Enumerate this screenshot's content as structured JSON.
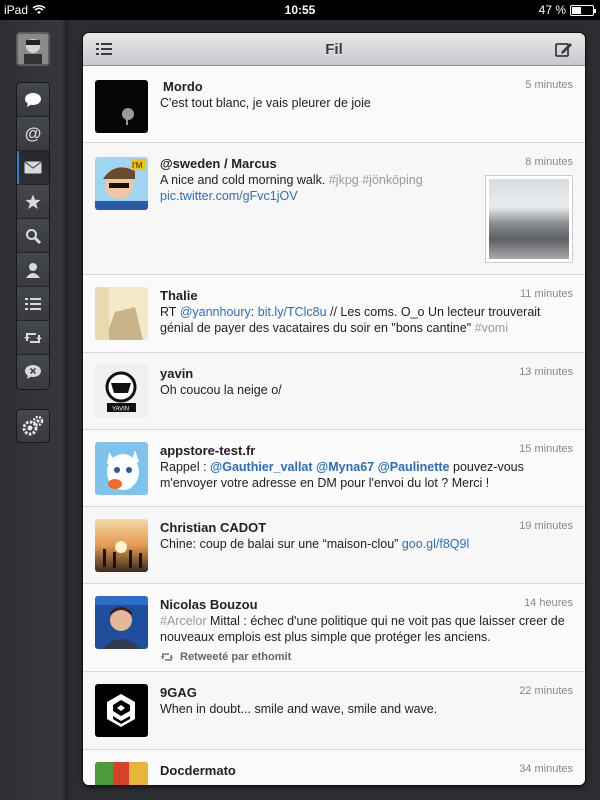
{
  "status_bar": {
    "device": "iPad",
    "time": "10:55",
    "battery": "47 %"
  },
  "sidebar": {
    "items": [
      {
        "name": "timeline",
        "icon": "speech-bubble-icon"
      },
      {
        "name": "mentions",
        "icon": "at-icon"
      },
      {
        "name": "messages",
        "icon": "envelope-icon"
      },
      {
        "name": "favorites",
        "icon": "star-icon"
      },
      {
        "name": "search",
        "icon": "search-icon"
      },
      {
        "name": "profile",
        "icon": "person-icon"
      },
      {
        "name": "lists",
        "icon": "list-icon"
      },
      {
        "name": "retweets",
        "icon": "retweet-icon"
      },
      {
        "name": "mute",
        "icon": "mute-icon"
      }
    ],
    "active": "messages",
    "accent_color": "#2a7fd4"
  },
  "header": {
    "title": "Fil"
  },
  "tweets": [
    {
      "name": "Mordo",
      "time": "5 minutes",
      "text": "C'est tout blanc, je vais pleurer de joie"
    },
    {
      "name": "@sweden / Marcus",
      "time": "8 minutes",
      "text_plain": "A nice and cold morning walk.",
      "hashtags": "#jkpg #jönköping",
      "link": "pic.twitter.com/gFvc1jOV"
    },
    {
      "name": "Thalie",
      "time": "11 minutes",
      "prefix": "RT",
      "mention": "@yannhoury",
      "colon": ":",
      "link": "bit.ly/TClc8u",
      "text_rest": "// Les coms. O_o Un lecteur trouverait génial de payer des vacataires du soir en \"bons cantine\"",
      "hashtag": "#vomi"
    },
    {
      "name": "yavin",
      "time": "13 minutes",
      "text": "Oh coucou la neige o/"
    },
    {
      "name": "appstore-test.fr",
      "time": "15 minutes",
      "prefix": "Rappel :",
      "mention1": "@Gauthier_vallat",
      "mention2": "@Myna67",
      "mention3": "@Paulinette",
      "text_rest": "pouvez-vous m'envoyer votre adresse en DM pour l'envoi du lot ? Merci !"
    },
    {
      "name": "Christian CADOT",
      "time": "19 minutes",
      "text_plain": "Chine: coup de balai sur une “maison-clou”",
      "link": "goo.gl/f8Q9l"
    },
    {
      "name": "Nicolas Bouzou",
      "time": "14 heures",
      "hashtag": "#Arcelor",
      "text_rest": "Mittal : échec d'une politique qui ne voit pas que laisser creer de nouveaux emplois est plus simple que protéger les anciens.",
      "retweet_label": "Retweeté par ethomit"
    },
    {
      "name": "9GAG",
      "time": "22 minutes",
      "text": "When in doubt... smile and wave, smile and wave."
    },
    {
      "name": "Docdermato",
      "time": "34 minutes"
    }
  ]
}
